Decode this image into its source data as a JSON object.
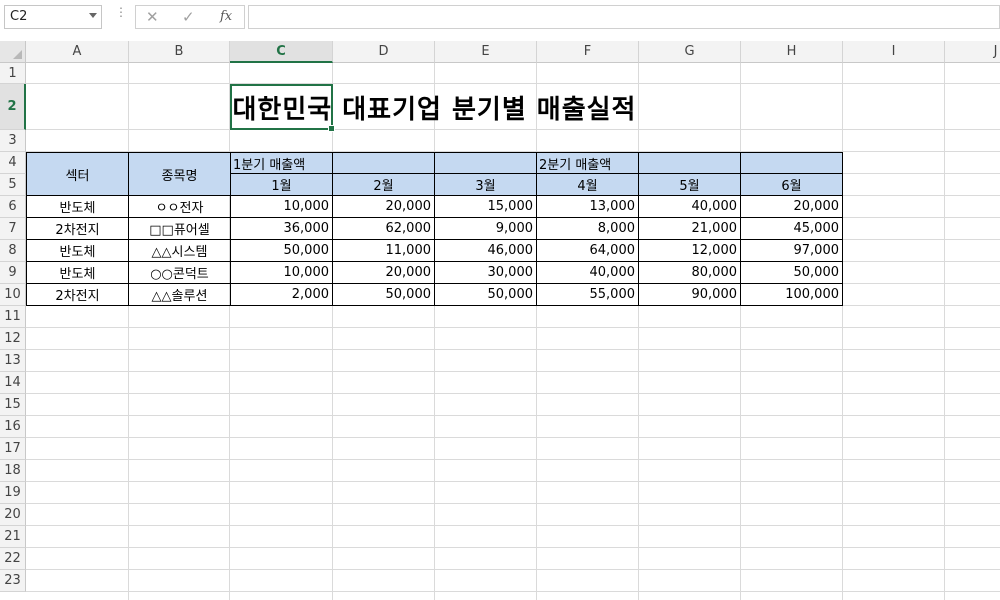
{
  "name_box": {
    "value": "C2"
  },
  "formula_bar": {
    "fx_label": "fx",
    "cancel_symbol": "✕",
    "enter_symbol": "✓",
    "value": ""
  },
  "columns": [
    "A",
    "B",
    "C",
    "D",
    "E",
    "F",
    "G",
    "H",
    "I",
    "J"
  ],
  "active_column": "C",
  "rows": [
    "1",
    "2",
    "3",
    "4",
    "5",
    "6",
    "7",
    "8",
    "9",
    "10",
    "11",
    "12",
    "13",
    "14",
    "15",
    "16",
    "17",
    "18",
    "19",
    "20",
    "21",
    "22",
    "23"
  ],
  "active_row": "2",
  "sheet": {
    "title": "대한민국 대표기업 분기별 매출실적",
    "header": {
      "sector": "섹터",
      "stock_name": "종목명",
      "q1_label": "1분기 매출액",
      "q2_label": "2분기 매출액",
      "months": [
        "1월",
        "2월",
        "3월",
        "4월",
        "5월",
        "6월"
      ]
    },
    "data_rows": [
      {
        "sector": "반도체",
        "name": "ㅇㅇ전자",
        "values": [
          "10,000",
          "20,000",
          "15,000",
          "13,000",
          "40,000",
          "20,000"
        ]
      },
      {
        "sector": "2차전지",
        "name": "□□퓨어셀",
        "values": [
          "36,000",
          "62,000",
          "9,000",
          "8,000",
          "21,000",
          "45,000"
        ]
      },
      {
        "sector": "반도체",
        "name": "△△시스템",
        "values": [
          "50,000",
          "11,000",
          "46,000",
          "64,000",
          "12,000",
          "97,000"
        ]
      },
      {
        "sector": "반도체",
        "name": "○○콘덕트",
        "values": [
          "10,000",
          "20,000",
          "30,000",
          "40,000",
          "80,000",
          "50,000"
        ]
      },
      {
        "sector": "2차전지",
        "name": "△△솔루션",
        "values": [
          "2,000",
          "50,000",
          "50,000",
          "55,000",
          "90,000",
          "100,000"
        ]
      }
    ]
  },
  "colors": {
    "header_fill": "#c5d9f1",
    "selection": "#217346"
  }
}
